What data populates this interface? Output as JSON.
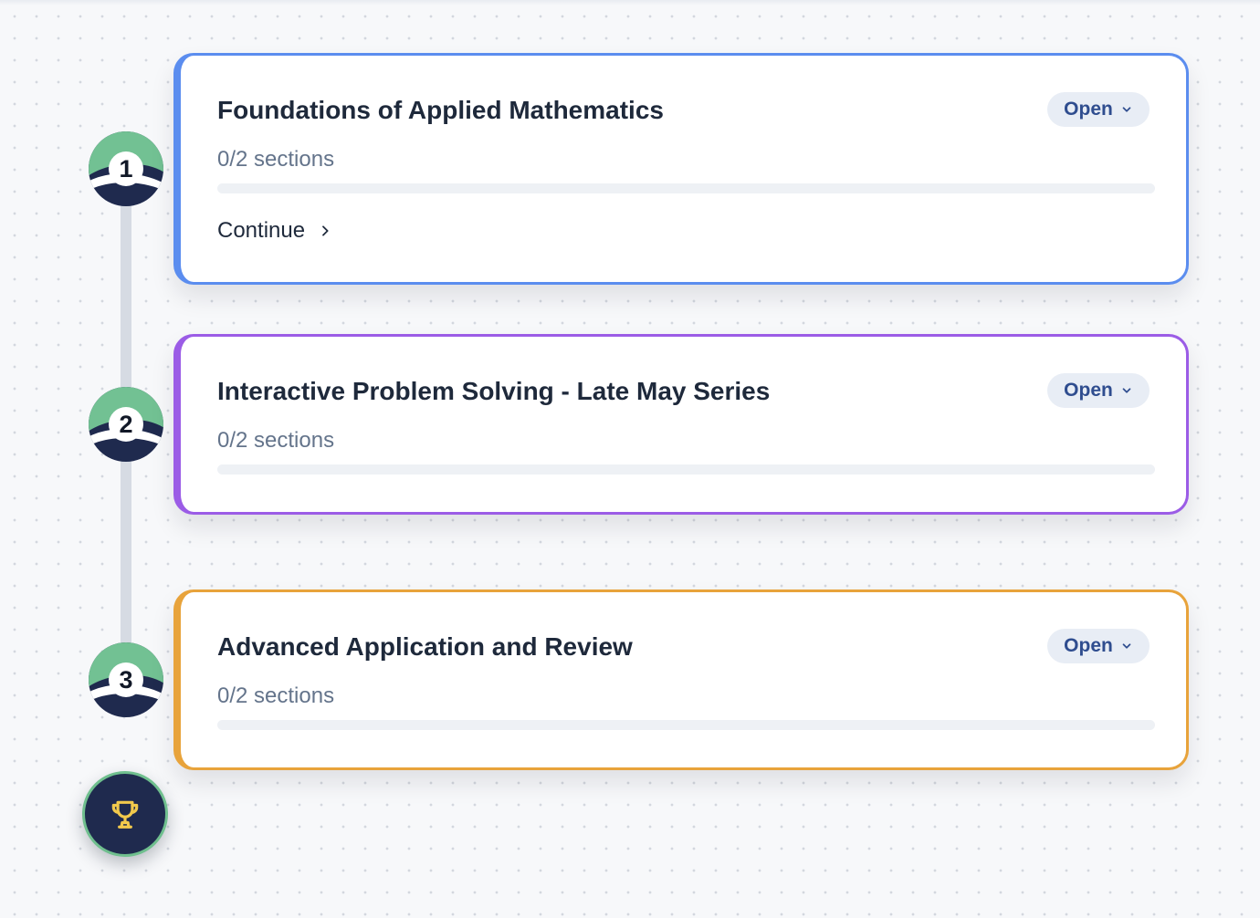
{
  "modules": [
    {
      "number": "1",
      "title": "Foundations of Applied Mathematics",
      "sections_text": "0/2 sections",
      "progress": 0,
      "status_label": "Open",
      "continue_label": "Continue",
      "border_color": "#5b8def"
    },
    {
      "number": "2",
      "title": "Interactive Problem Solving - Late May Series",
      "sections_text": "0/2 sections",
      "progress": 0,
      "status_label": "Open",
      "border_color": "#9b5ce6"
    },
    {
      "number": "3",
      "title": "Advanced Application and Review",
      "sections_text": "0/2 sections",
      "progress": 0,
      "status_label": "Open",
      "border_color": "#e8a33b"
    }
  ],
  "final_badge": {
    "icon": "trophy-icon",
    "icon_color": "#f2c94c",
    "background": "#1f2a4e",
    "ring_color": "#6fbf8e"
  }
}
